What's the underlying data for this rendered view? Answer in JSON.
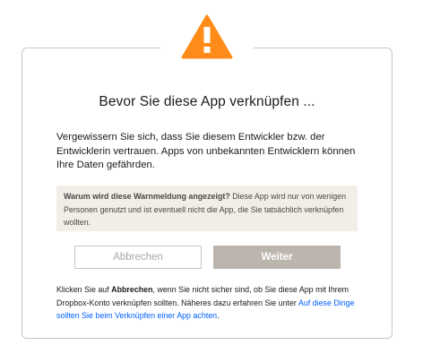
{
  "dialog": {
    "icon": "warning-triangle-icon",
    "accent_color": "#ff8c19",
    "title": "Bevor Sie diese App verknüpfen ...",
    "intro": "Vergewissern Sie sich, dass Sie diesem Entwickler bzw. der Entwicklerin vertrauen. Apps von unbekannten Entwicklern können Ihre Daten gefährden.",
    "info_box": {
      "question": "Warum wird diese Warnmeldung angezeigt?",
      "answer": " Diese App wird nur von wenigen Personen genutzt und ist eventuell nicht die App, die Sie tatsächlich verknüpfen wollten."
    },
    "buttons": {
      "cancel_label": "Abbrechen",
      "continue_label": "Weiter"
    },
    "footnote": {
      "part1": "Klicken Sie auf ",
      "cancel_word": "Abbrechen",
      "part2": ", wenn Sie nicht sicher sind, ob Sie diese App mit Ihrem Dropbox-Konto verknüpfen sollten. Näheres dazu erfahren Sie unter ",
      "link_text": "Auf diese Dinge sollten Sie beim Verknüpfen einer App achten",
      "part3": "."
    }
  }
}
